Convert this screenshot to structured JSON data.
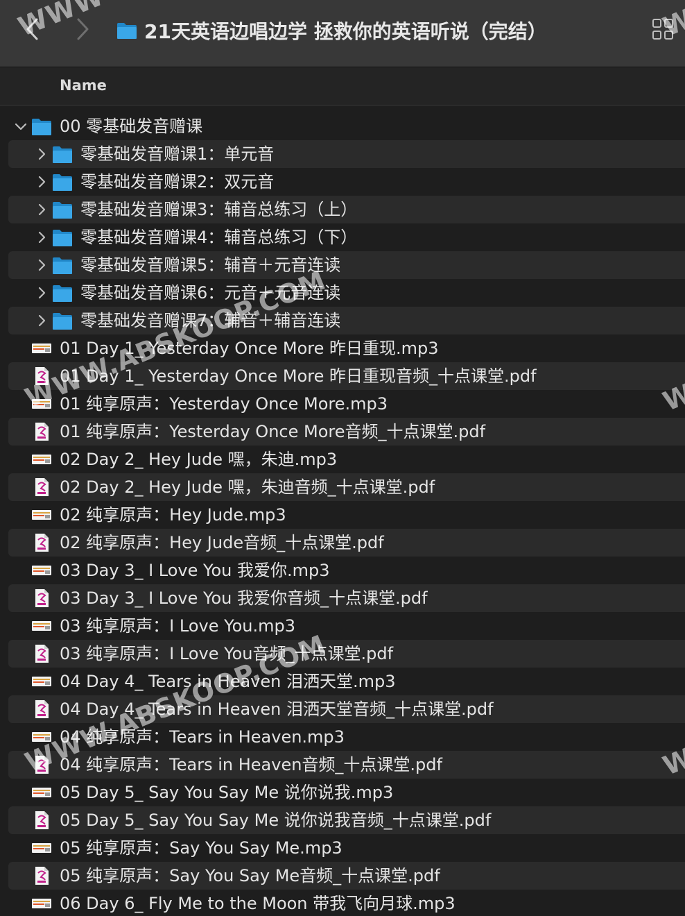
{
  "window": {
    "title": "21天英语边唱边学 拯救你的英语听说（完结）"
  },
  "header": {
    "name_column": "Name"
  },
  "colors": {
    "folder": "#3aa7e8",
    "folder_dark": "#2187c8",
    "toolbar": "#383838",
    "row_alt": "#2b2b2b",
    "pdf_accent": "#c0208a"
  },
  "rows": [
    {
      "label": "00 零基础发音赠课",
      "type": "folder",
      "level": 0,
      "expanded": true
    },
    {
      "label": "零基础发音赠课1：单元音",
      "type": "folder",
      "level": 1,
      "expanded": false
    },
    {
      "label": "零基础发音赠课2：双元音",
      "type": "folder",
      "level": 1,
      "expanded": false
    },
    {
      "label": "零基础发音赠课3：辅音总练习（上）",
      "type": "folder",
      "level": 1,
      "expanded": false
    },
    {
      "label": "零基础发音赠课4：辅音总练习（下）",
      "type": "folder",
      "level": 1,
      "expanded": false
    },
    {
      "label": "零基础发音赠课5：辅音＋元音连读",
      "type": "folder",
      "level": 1,
      "expanded": false
    },
    {
      "label": "零基础发音赠课6：元音＋元音连读",
      "type": "folder",
      "level": 1,
      "expanded": false
    },
    {
      "label": "零基础发音赠课7：辅音＋辅音连读",
      "type": "folder",
      "level": 1,
      "expanded": false
    },
    {
      "label": "01 Day 1_ Yesterday Once More 昨日重现.mp3",
      "type": "mp3",
      "level": 0
    },
    {
      "label": "01 Day 1_ Yesterday Once More 昨日重现音频_十点课堂.pdf",
      "type": "pdf",
      "level": 0
    },
    {
      "label": "01 纯享原声：Yesterday Once More.mp3",
      "type": "mp3",
      "level": 0
    },
    {
      "label": "01 纯享原声：Yesterday Once More音频_十点课堂.pdf",
      "type": "pdf",
      "level": 0
    },
    {
      "label": "02 Day 2_ Hey Jude 嘿，朱迪.mp3",
      "type": "mp3",
      "level": 0
    },
    {
      "label": "02 Day 2_ Hey Jude 嘿，朱迪音频_十点课堂.pdf",
      "type": "pdf",
      "level": 0
    },
    {
      "label": "02 纯享原声：Hey Jude.mp3",
      "type": "mp3",
      "level": 0
    },
    {
      "label": "02 纯享原声：Hey Jude音频_十点课堂.pdf",
      "type": "pdf",
      "level": 0
    },
    {
      "label": "03 Day 3_ I Love You 我爱你.mp3",
      "type": "mp3",
      "level": 0
    },
    {
      "label": "03 Day 3_ I Love You 我爱你音频_十点课堂.pdf",
      "type": "pdf",
      "level": 0
    },
    {
      "label": "03 纯享原声：I Love You.mp3",
      "type": "mp3",
      "level": 0
    },
    {
      "label": "03 纯享原声：I Love You音频_十点课堂.pdf",
      "type": "pdf",
      "level": 0
    },
    {
      "label": "04 Day 4_ Tears in Heaven 泪洒天堂.mp3",
      "type": "mp3",
      "level": 0
    },
    {
      "label": "04 Day 4_ Tears in Heaven 泪洒天堂音频_十点课堂.pdf",
      "type": "pdf",
      "level": 0
    },
    {
      "label": "04 纯享原声：Tears in Heaven.mp3",
      "type": "mp3",
      "level": 0
    },
    {
      "label": "04 纯享原声：Tears in Heaven音频_十点课堂.pdf",
      "type": "pdf",
      "level": 0
    },
    {
      "label": "05 Day 5_ Say You Say Me 说你说我.mp3",
      "type": "mp3",
      "level": 0
    },
    {
      "label": "05 Day 5_ Say You Say Me 说你说我音频_十点课堂.pdf",
      "type": "pdf",
      "level": 0
    },
    {
      "label": "05 纯享原声：Say You Say Me.mp3",
      "type": "mp3",
      "level": 0
    },
    {
      "label": "05 纯享原声：Say You Say Me音频_十点课堂.pdf",
      "type": "pdf",
      "level": 0
    },
    {
      "label": "06 Day 6_ Fly Me to the Moon 带我飞向月球.mp3",
      "type": "mp3",
      "level": 0
    }
  ],
  "watermarks": [
    {
      "text": "WWW.ABSKOOP.COM"
    },
    {
      "text": "WWW.ABSKOOP.COM"
    },
    {
      "text": "WWW"
    },
    {
      "text": "WWW"
    },
    {
      "text": "WWW"
    },
    {
      "text": "WWW"
    }
  ]
}
